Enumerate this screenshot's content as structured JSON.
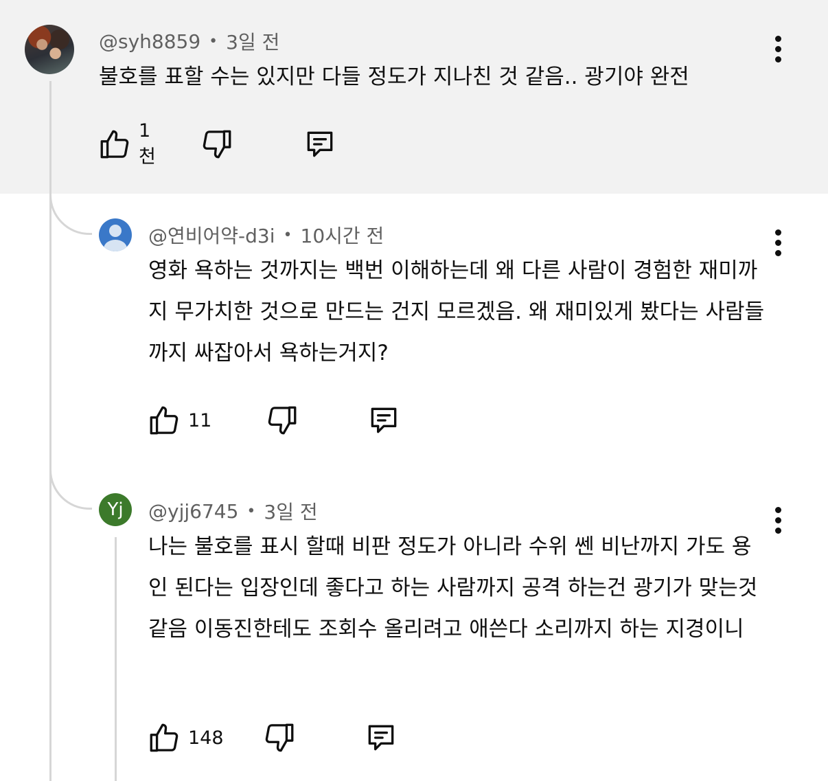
{
  "colors": {
    "highlight_bg": "#f2f2f2",
    "meta_text": "#606060",
    "thread_line": "#d6d6d6",
    "avatar_default_bg": "#3a78c8",
    "avatar_letter_bg": "#3c7a2b"
  },
  "comments": [
    {
      "author": "@syh8859",
      "time": "3일 전",
      "text": "불호를 표할 수는 있지만 다들 정도가 지나친 것 같음.. 광기야 완전",
      "likes": "1천",
      "avatar": "photo",
      "icons": [
        "thumbs-up-icon",
        "thumbs-down-icon",
        "reply-icon",
        "more-vertical-icon"
      ]
    },
    {
      "author": "@연비어약-d3i",
      "time": "10시간 전",
      "text": "영화 욕하는 것까지는 백번 이해하는데 왜 다른 사람이 경험한 재미까지 무가치한 것으로 만드는 건지 모르겠음. 왜 재미있게 봤다는 사람들까지 싸잡아서 욕하는거지?",
      "likes": "11",
      "avatar": "default-person",
      "icons": [
        "thumbs-up-icon",
        "thumbs-down-icon",
        "reply-icon",
        "more-vertical-icon"
      ]
    },
    {
      "author": "@yjj6745",
      "time": "3일 전",
      "text": "나는 불호를 표시 할때 비판 정도가 아니라 수위 쎈 비난까지 가도 용인 된다는 입장인데 좋다고 하는 사람까지 공격 하는건 광기가 맞는것 같음 이동진한테도 조회수 올리려고 애쓴다 소리까지 하는 지경이니",
      "likes": "148",
      "avatar_letter": "Yj",
      "icons": [
        "thumbs-up-icon",
        "thumbs-down-icon",
        "reply-icon",
        "more-vertical-icon"
      ]
    }
  ]
}
